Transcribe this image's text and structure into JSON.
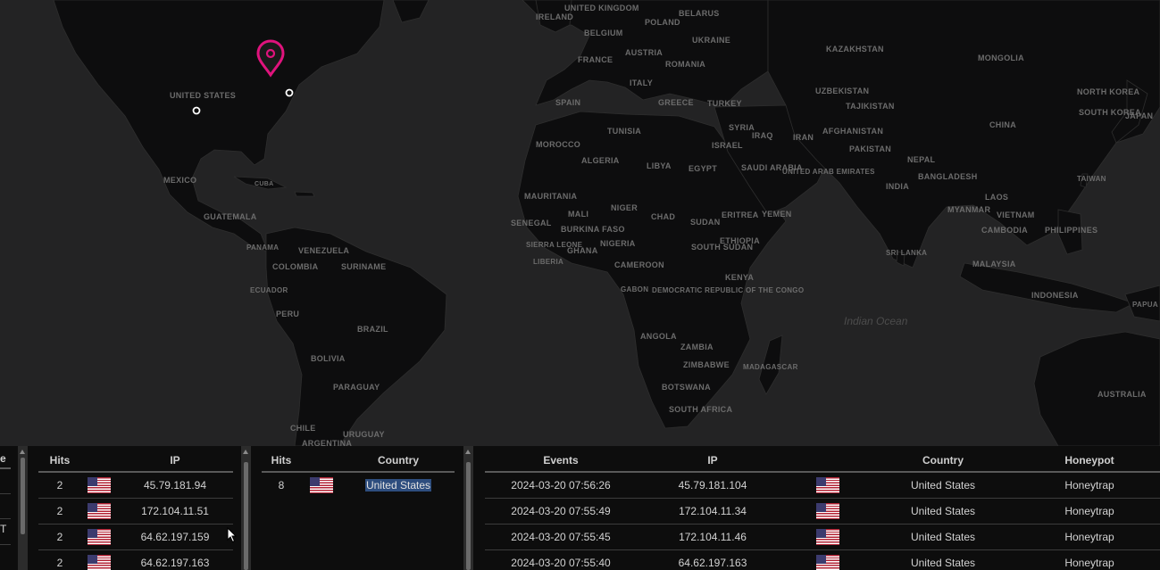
{
  "map": {
    "countries": [
      "UNITED STATES",
      "MEXICO",
      "CUBA",
      "GUATEMALA",
      "PANAMA",
      "VENEZUELA",
      "COLOMBIA",
      "SURINAME",
      "ECUADOR",
      "PERU",
      "BRAZIL",
      "BOLIVIA",
      "PARAGUAY",
      "CHILE",
      "URUGUAY",
      "ARGENTINA",
      "IRELAND",
      "UNITED KINGDOM",
      "BELGIUM",
      "FRANCE",
      "SPAIN",
      "AUSTRIA",
      "POLAND",
      "BELARUS",
      "UKRAINE",
      "ROMANIA",
      "ITALY",
      "GREECE",
      "TURKEY",
      "TUNISIA",
      "MOROCCO",
      "ALGERIA",
      "LIBYA",
      "EGYPT",
      "MAURITANIA",
      "MALI",
      "NIGER",
      "CHAD",
      "SUDAN",
      "SENEGAL",
      "BURKINA FASO",
      "SIERRA LEONE",
      "LIBERIA",
      "GHANA",
      "NIGERIA",
      "CAMEROON",
      "SOUTH SUDAN",
      "ETHIOPIA",
      "ERITREA",
      "YEMEN",
      "SAUDI ARABIA",
      "UNITED ARAB EMIRATES",
      "SYRIA",
      "ISRAEL",
      "IRAQ",
      "IRAN",
      "KENYA",
      "GABON",
      "DEMOCRATIC REPUBLIC OF THE CONGO",
      "ANGOLA",
      "ZAMBIA",
      "ZIMBABWE",
      "BOTSWANA",
      "SOUTH AFRICA",
      "MADAGASCAR",
      "KAZAKHSTAN",
      "UZBEKISTAN",
      "TAJIKISTAN",
      "AFGHANISTAN",
      "PAKISTAN",
      "NEPAL",
      "INDIA",
      "BANGLADESH",
      "SRI LANKA",
      "MYANMAR",
      "LAOS",
      "VIETNAM",
      "CAMBODIA",
      "PHILIPPINES",
      "MALAYSIA",
      "INDONESIA",
      "MONGOLIA",
      "CHINA",
      "NORTH KOREA",
      "SOUTH KOREA",
      "JAPAN",
      "TAIWAN",
      "AUSTRALIA",
      "PAPUA"
    ],
    "ocean_label": "Indian Ocean",
    "marker_color": "#e0137d"
  },
  "panel_partial": {
    "header_fragment": "e",
    "row_fragment": "T"
  },
  "panel_ip": {
    "headers": [
      "Hits",
      "",
      "IP"
    ],
    "rows": [
      {
        "hits": "2",
        "flag": "us-flag",
        "ip": "45.79.181.94"
      },
      {
        "hits": "2",
        "flag": "us-flag",
        "ip": "172.104.11.51"
      },
      {
        "hits": "2",
        "flag": "us-flag",
        "ip": "64.62.197.159"
      },
      {
        "hits": "2",
        "flag": "us-flag",
        "ip": "64.62.197.163"
      }
    ]
  },
  "panel_country": {
    "headers": [
      "Hits",
      "",
      "Country"
    ],
    "rows": [
      {
        "hits": "8",
        "flag": "us-flag",
        "country": "United States"
      }
    ]
  },
  "panel_events": {
    "headers": [
      "Events",
      "IP",
      "",
      "Country",
      "Honeypot"
    ],
    "rows": [
      {
        "time": "2024-03-20 07:56:26",
        "ip": "45.79.181.104",
        "flag": "us-flag",
        "country": "United States",
        "honeypot": "Honeytrap"
      },
      {
        "time": "2024-03-20 07:55:49",
        "ip": "172.104.11.34",
        "flag": "us-flag",
        "country": "United States",
        "honeypot": "Honeytrap"
      },
      {
        "time": "2024-03-20 07:55:45",
        "ip": "172.104.11.46",
        "flag": "us-flag",
        "country": "United States",
        "honeypot": "Honeytrap"
      },
      {
        "time": "2024-03-20 07:55:40",
        "ip": "64.62.197.163",
        "flag": "us-flag",
        "country": "United States",
        "honeypot": "Honeytrap"
      }
    ]
  }
}
